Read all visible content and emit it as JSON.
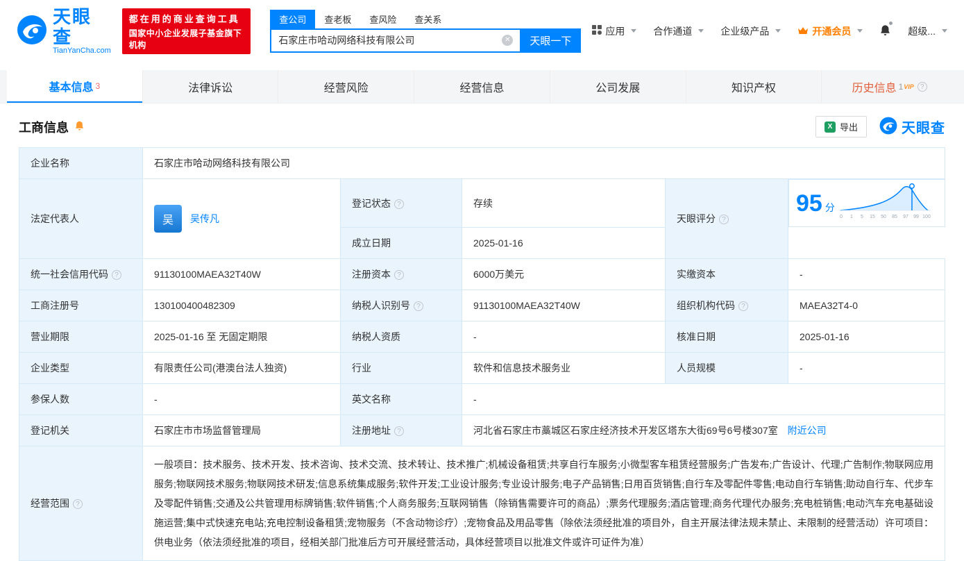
{
  "brand": {
    "name": "天眼查",
    "domain": "TianYanCha.com"
  },
  "promo": {
    "line1": "都在用的商业查询工具",
    "line2": "国家中小企业发展子基金旗下机构"
  },
  "search": {
    "tabs": [
      {
        "label": "查公司"
      },
      {
        "label": "查老板"
      },
      {
        "label": "查风险"
      },
      {
        "label": "查关系"
      }
    ],
    "value": "石家庄市哈动网络科技有限公司",
    "button_label": "天眼一下"
  },
  "topnav": {
    "apps": "应用",
    "cooperation": "合作通道",
    "enterprise": "企业级产品",
    "vip": "开通会员",
    "user": "超级..."
  },
  "page_tabs": [
    {
      "label": "基本信息",
      "badge": "3"
    },
    {
      "label": "法律诉讼"
    },
    {
      "label": "经营风险"
    },
    {
      "label": "经营信息"
    },
    {
      "label": "公司发展"
    },
    {
      "label": "知识产权"
    },
    {
      "label": "历史信息",
      "badge": "1",
      "vip_tag": "VIP"
    }
  ],
  "section": {
    "title": "工商信息",
    "export_label": "导出"
  },
  "info": {
    "company_name_label": "企业名称",
    "company_name": "石家庄市哈动网络科技有限公司",
    "legal_rep_label": "法定代表人",
    "legal_rep_avatar_char": "吴",
    "legal_rep_name": "吴传凡",
    "reg_status_label": "登记状态",
    "reg_status": "存续",
    "est_date_label": "成立日期",
    "est_date": "2025-01-16",
    "score_label": "天眼评分",
    "uscc_label": "统一社会信用代码",
    "uscc": "91130100MAEA32T40W",
    "reg_capital_label": "注册资本",
    "reg_capital": "6000万美元",
    "paid_capital_label": "实缴资本",
    "paid_capital": "-",
    "reg_number_label": "工商注册号",
    "reg_number": "130100400482309",
    "taxpayer_id_label": "纳税人识别号",
    "taxpayer_id": "91130100MAEA32T40W",
    "org_code_label": "组织机构代码",
    "org_code": "MAEA32T4-0",
    "business_term_label": "营业期限",
    "business_term": "2025-01-16 至 无固定期限",
    "taxpayer_quality_label": "纳税人资质",
    "taxpayer_quality": "-",
    "approval_date_label": "核准日期",
    "approval_date": "2025-01-16",
    "company_type_label": "企业类型",
    "company_type": "有限责任公司(港澳台法人独资)",
    "industry_label": "行业",
    "industry": "软件和信息技术服务业",
    "staff_size_label": "人员规模",
    "staff_size": "-",
    "insured_label": "参保人数",
    "insured": "-",
    "english_name_label": "英文名称",
    "english_name": "-",
    "reg_authority_label": "登记机关",
    "reg_authority": "石家庄市市场监督管理局",
    "reg_address_label": "注册地址",
    "reg_address": "河北省石家庄市藁城区石家庄经济技术开发区塔东大街69号6号楼307室",
    "nearby_link": "附近公司",
    "business_scope_label": "经营范围",
    "business_scope": "一般项目：技术服务、技术开发、技术咨询、技术交流、技术转让、技术推广;机械设备租赁;共享自行车服务;小微型客车租赁经营服务;广告发布;广告设计、代理;广告制作;物联网应用服务;物联网技术服务;物联网技术研发;信息系统集成服务;软件开发;工业设计服务;专业设计服务;电子产品销售;日用百货销售;自行车及零配件零售;电动自行车销售;助动自行车、代步车及零配件销售;交通及公共管理用标牌销售;软件销售;个人商务服务;互联网销售（除销售需要许可的商品）;票务代理服务;酒店管理;商务代理代办服务;充电桩销售;电动汽车充电基础设施运营;集中式快速充电站;充电控制设备租赁;宠物服务（不含动物诊疗）;宠物食品及用品零售（除依法须经批准的项目外，自主开展法律法规未禁止、未限制的经营活动）许可项目：供电业务（依法须经批准的项目，经相关部门批准后方可开展经营活动，具体经营项目以批准文件或许可证件为准）"
  },
  "score_chart": {
    "score": "95",
    "unit": "分",
    "ticks": [
      "0",
      "1",
      "5",
      "15",
      "50",
      "85",
      "97",
      "99",
      "100"
    ]
  },
  "colors": {
    "brand_blue": "#0084ff",
    "promo_red": "#e60012",
    "status_green": "#2aa158",
    "member_orange": "#ff8000",
    "history_orange": "#e25f3b"
  }
}
